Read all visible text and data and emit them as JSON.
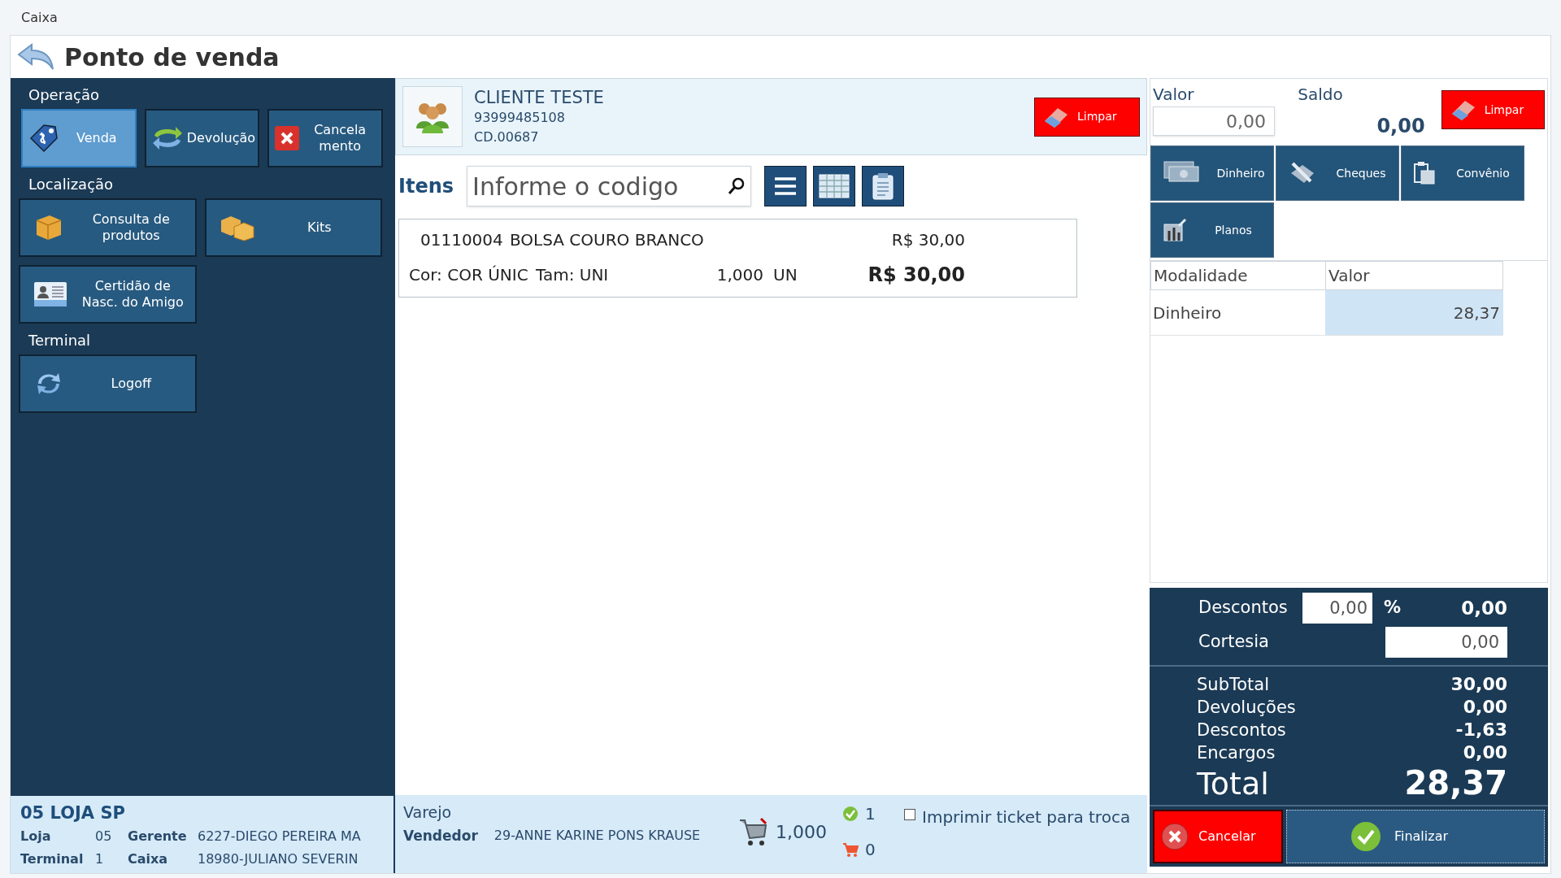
{
  "window": {
    "title": "Caixa"
  },
  "header": {
    "title": "Ponto de venda"
  },
  "sidebar": {
    "sections": [
      {
        "title": "Operação",
        "buttons": [
          {
            "label": "Venda",
            "kind": "sale",
            "selected": true
          },
          {
            "label": "Devolução",
            "kind": "return",
            "selected": false
          },
          {
            "label": "Cancela mento",
            "kind": "cancel",
            "selected": false
          }
        ]
      },
      {
        "title": "Localização",
        "buttons": [
          {
            "label": "Consulta de produtos",
            "kind": "box"
          },
          {
            "label": "Kits",
            "kind": "boxes"
          },
          {
            "label": "Certidão de Nasc. do Amigo",
            "kind": "card"
          }
        ]
      },
      {
        "title": "Terminal",
        "buttons": [
          {
            "label": "Logoff",
            "kind": "refresh"
          }
        ]
      }
    ]
  },
  "store": {
    "name": "05 LOJA SP",
    "fields": [
      {
        "label": "Loja",
        "value": "05"
      },
      {
        "label": "Gerente",
        "value": "6227-DIEGO PEREIRA MA"
      },
      {
        "label": "Terminal",
        "value": "1"
      },
      {
        "label": "Caixa",
        "value": "18980-JULIANO SEVERIN"
      }
    ]
  },
  "customer": {
    "name": "CLIENTE TESTE",
    "phone": "93999485108",
    "code": "CD.00687",
    "clear_button": "Limpar"
  },
  "items": {
    "label": "Itens",
    "search": {
      "placeholder": "Informe o codigo"
    },
    "views": [
      {
        "kind": "list"
      },
      {
        "kind": "grid"
      },
      {
        "kind": "clipboard"
      }
    ],
    "rows": [
      {
        "code": "01110004",
        "description": "BOLSA COURO BRANCO",
        "unit_price": "R$ 30,00",
        "color_label": "Cor: COR ÚNIC",
        "size": "Tam: UNI",
        "quantity": "1,000",
        "unit": "UN",
        "total": "R$ 30,00"
      }
    ]
  },
  "sale_info": {
    "price_table": "Varejo",
    "seller_label": "Vendedor",
    "seller": "29-ANNE KARINE PONS KRAUSE",
    "quantity": "1,000",
    "checked_count": "1",
    "cart_count": "0",
    "print_ticket": {
      "label": "Imprimir ticket para troca",
      "checked": false
    }
  },
  "payment": {
    "value_label": "Valor",
    "value": "0,00",
    "balance_label": "Saldo",
    "balance": "0,00",
    "clear_button": "Limpar",
    "methods": [
      {
        "label": "Dinheiro",
        "kind": "cash"
      },
      {
        "label": "Cheques",
        "kind": "check"
      },
      {
        "label": "Convênio",
        "kind": "agreement"
      },
      {
        "label": "Planos",
        "kind": "plans"
      }
    ],
    "table": {
      "columns": [
        "Modalidade",
        "Valor"
      ],
      "rows": [
        {
          "method": "Dinheiro",
          "value": "28,37"
        }
      ]
    }
  },
  "adjustments": {
    "discount": {
      "label": "Descontos",
      "value": "0,00",
      "unit": "%",
      "amount": "0,00"
    },
    "courtesy": {
      "label": "Cortesia",
      "value": "0,00"
    }
  },
  "totals": {
    "rows": [
      {
        "label": "SubTotal",
        "value": "30,00"
      },
      {
        "label": "Devoluções",
        "value": "0,00"
      },
      {
        "label": "Descontos",
        "value": "-1,63"
      },
      {
        "label": "Encargos",
        "value": "0,00"
      }
    ],
    "total": {
      "label": "Total",
      "value": "28,37"
    }
  },
  "actions": {
    "cancel": "Cancelar",
    "finish": "Finalizar"
  }
}
